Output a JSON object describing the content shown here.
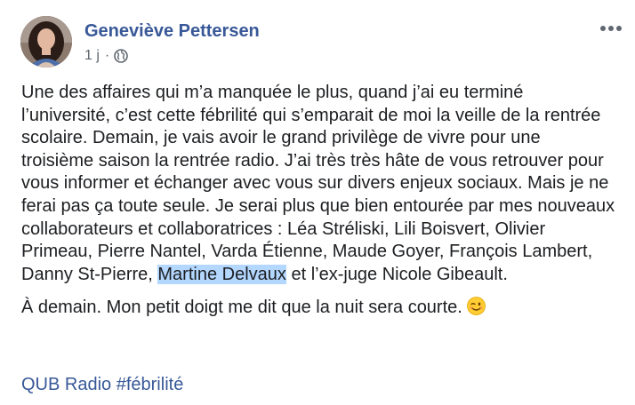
{
  "post": {
    "author": "Geneviève Pettersen",
    "timestamp": "1 j",
    "separator": "·",
    "privacy_icon": "globe-icon",
    "more_icon": "more-options-icon",
    "paragraph1_before": "Une des affaires qui m’a manquée le plus, quand j’ai eu terminé l’université, c’est cette fébrilité qui s’emparait de moi la veille de la rentrée scolaire. Demain, je vais avoir le grand privilège de vivre pour une troisième saison la rentrée radio. J’ai très très hâte de vous retrouver pour vous informer et échanger avec vous sur divers enjeux sociaux. Mais je ne ferai pas ça toute seule. Je serai plus que bien entourée par mes nouveaux collaborateurs et collaboratrices : Léa Stréliski, Lili Boisvert, Olivier Primeau, Pierre Nantel, Varda Étienne, Maude Goyer, François Lambert, Danny St-Pierre, ",
    "paragraph1_highlight": "Martine Delvaux",
    "paragraph1_after": " et l’ex-juge Nicole Gibeault.",
    "paragraph2": "À demain. Mon petit doigt me dit que la nuit sera courte.",
    "emoji": "winking-face-emoji",
    "hashtag1": "QUB Radio",
    "hashtag2": "#fébrilité",
    "colors": {
      "link": "#385898",
      "text": "#1c1e21",
      "meta": "#606770",
      "highlight": "#b4d7ff"
    }
  }
}
